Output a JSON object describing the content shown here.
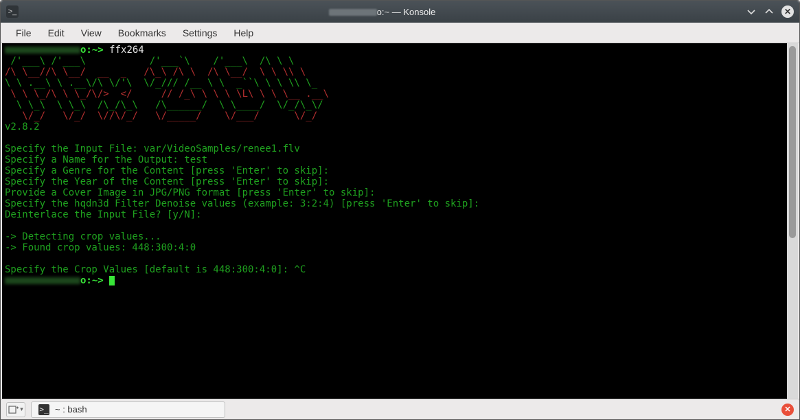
{
  "titlebar": {
    "title_suffix": "o:~ — Konsole"
  },
  "menubar": {
    "items": [
      "File",
      "Edit",
      "View",
      "Bookmarks",
      "Settings",
      "Help"
    ]
  },
  "terminal": {
    "prompt1_cmd": "ffx264",
    "prompt_path_suffix": "o:~>",
    "ascii": {
      "l1": " /'___\\ /'___\\           /'___`\\    /'___\\  /\\ \\ \\",
      "l2": "/\\ \\__//\\ \\__/  __  _   /\\_\\ /\\ \\  /\\ \\__/  \\ \\ \\\\ \\",
      "l3": "\\ \\ .__\\ \\ .__\\/\\ \\/'\\  \\/_/// /__ \\ \\  _``\\ \\ \\ \\\\ \\_",
      "l4": " \\ \\ \\_/\\ \\ \\_/\\/>  </     // /_\\ \\ \\ \\ \\L\\ \\ \\ \\__ .__\\",
      "l5": "  \\ \\_\\  \\ \\_\\  /\\_/\\_\\   /\\______/  \\ \\____/  \\/_/\\_\\/",
      "l6": "   \\/_/   \\/_/  \\//\\/_/   \\/_____/    \\/___/      \\/_/"
    },
    "version": "v2.8.2",
    "lines": {
      "l1": "Specify the Input File: var/VideoSamples/renee1.flv",
      "l2": "Specify a Name for the Output: test",
      "l3": "Specify a Genre for the Content [press 'Enter' to skip]:",
      "l4": "Specify the Year of the Content [press 'Enter' to skip]:",
      "l5": "Provide a Cover Image in JPG/PNG format [press 'Enter' to skip]:",
      "l6": "Specify the hqdn3d Filter Denoise values (example: 3:2:4) [press 'Enter' to skip]:",
      "l7": "Deinterlace the Input File? [y/N]:",
      "l8": "-> Detecting crop values...",
      "l9": "-> Found crop values: 448:300:4:0",
      "l10": "Specify the Crop Values [default is 448:300:4:0]: ^C"
    }
  },
  "bottombar": {
    "tab_label": "~ : bash"
  }
}
